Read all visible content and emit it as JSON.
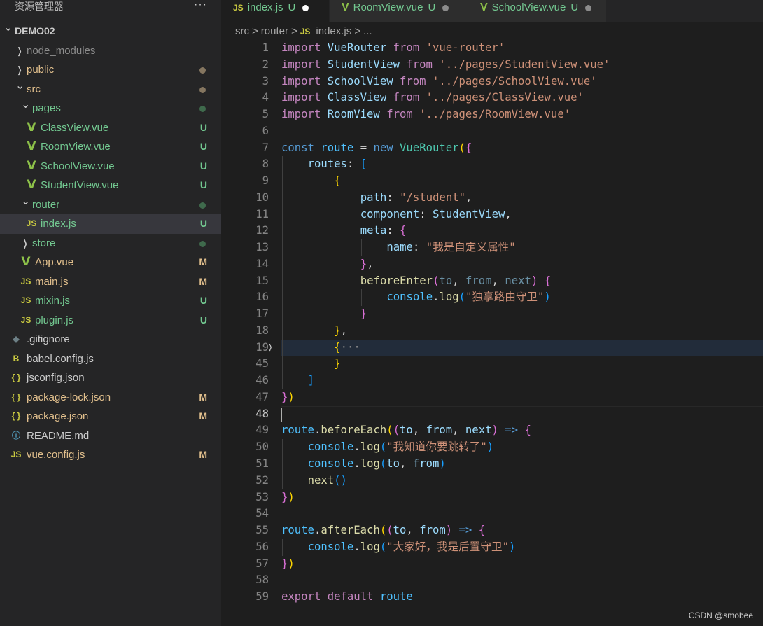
{
  "sidebar": {
    "title": "资源管理器",
    "more": "···",
    "items": [
      {
        "label": "DEMO02",
        "depth": 0,
        "kind": "folder-open",
        "color": "#cccccc",
        "bold": true
      },
      {
        "label": "node_modules",
        "depth": 1,
        "kind": "folder",
        "color": "#8c8c8c"
      },
      {
        "label": "public",
        "depth": 1,
        "kind": "folder",
        "color": "#e2c08d",
        "dot": "#857660"
      },
      {
        "label": "src",
        "depth": 1,
        "kind": "folder-open",
        "color": "#e2c08d",
        "dot": "#857660"
      },
      {
        "label": "pages",
        "depth": 2,
        "kind": "folder-open",
        "color": "#73c991",
        "dot": "#3f6a4c"
      },
      {
        "label": "ClassView.vue",
        "depth": 3,
        "kind": "vue",
        "color": "#73c991",
        "status": "U"
      },
      {
        "label": "RoomView.vue",
        "depth": 3,
        "kind": "vue",
        "color": "#73c991",
        "status": "U"
      },
      {
        "label": "SchoolView.vue",
        "depth": 3,
        "kind": "vue",
        "color": "#73c991",
        "status": "U"
      },
      {
        "label": "StudentView.vue",
        "depth": 3,
        "kind": "vue",
        "color": "#73c991",
        "status": "U"
      },
      {
        "label": "router",
        "depth": 2,
        "kind": "folder-open",
        "color": "#73c991",
        "dot": "#3f6a4c"
      },
      {
        "label": "index.js",
        "depth": 3,
        "kind": "js",
        "color": "#73c991",
        "status": "U",
        "selected": true
      },
      {
        "label": "store",
        "depth": 2,
        "kind": "folder",
        "color": "#73c991",
        "dot": "#3f6a4c"
      },
      {
        "label": "App.vue",
        "depth": 2,
        "kind": "vue",
        "color": "#e2c08d",
        "status": "M"
      },
      {
        "label": "main.js",
        "depth": 2,
        "kind": "js",
        "color": "#e2c08d",
        "status": "M"
      },
      {
        "label": "mixin.js",
        "depth": 2,
        "kind": "js",
        "color": "#73c991",
        "status": "U"
      },
      {
        "label": "plugin.js",
        "depth": 2,
        "kind": "js",
        "color": "#73c991",
        "status": "U"
      },
      {
        "label": ".gitignore",
        "depth": 1,
        "kind": "git",
        "color": "#cccccc"
      },
      {
        "label": "babel.config.js",
        "depth": 1,
        "kind": "babel",
        "color": "#cccccc"
      },
      {
        "label": "jsconfig.json",
        "depth": 1,
        "kind": "json",
        "color": "#cccccc"
      },
      {
        "label": "package-lock.json",
        "depth": 1,
        "kind": "json",
        "color": "#e2c08d",
        "status": "M"
      },
      {
        "label": "package.json",
        "depth": 1,
        "kind": "json",
        "color": "#e2c08d",
        "status": "M"
      },
      {
        "label": "README.md",
        "depth": 1,
        "kind": "info",
        "color": "#cccccc"
      },
      {
        "label": "vue.config.js",
        "depth": 1,
        "kind": "js",
        "color": "#e2c08d",
        "status": "M"
      }
    ]
  },
  "tabs": [
    {
      "label": "index.js",
      "status": "U",
      "icon": "js",
      "active": true
    },
    {
      "label": "RoomView.vue",
      "status": "U",
      "icon": "vue"
    },
    {
      "label": "SchoolView.vue",
      "status": "U",
      "icon": "vue"
    }
  ],
  "breadcrumb": {
    "parts": [
      "src",
      "router",
      "index.js",
      "..."
    ],
    "sep": ">"
  },
  "editor": {
    "current_line": "48",
    "folded_line": "19",
    "lines": [
      {
        "n": "1",
        "i": 0,
        "t": [
          [
            "import ",
            "k"
          ],
          [
            "VueRouter ",
            "v"
          ],
          [
            "from ",
            "k"
          ],
          [
            "'vue-router'",
            "s"
          ]
        ]
      },
      {
        "n": "2",
        "i": 0,
        "t": [
          [
            "import ",
            "k"
          ],
          [
            "StudentView ",
            "v"
          ],
          [
            "from ",
            "k"
          ],
          [
            "'../pages/StudentView.vue'",
            "s"
          ]
        ]
      },
      {
        "n": "3",
        "i": 0,
        "t": [
          [
            "import ",
            "k"
          ],
          [
            "SchoolView ",
            "v"
          ],
          [
            "from ",
            "k"
          ],
          [
            "'../pages/SchoolView.vue'",
            "s"
          ]
        ]
      },
      {
        "n": "4",
        "i": 0,
        "t": [
          [
            "import ",
            "k"
          ],
          [
            "ClassView ",
            "v"
          ],
          [
            "from ",
            "k"
          ],
          [
            "'../pages/ClassView.vue'",
            "s"
          ]
        ]
      },
      {
        "n": "5",
        "i": 0,
        "t": [
          [
            "import ",
            "k"
          ],
          [
            "RoomView ",
            "v"
          ],
          [
            "from ",
            "k"
          ],
          [
            "'../pages/RoomView.vue'",
            "s"
          ]
        ]
      },
      {
        "n": "6",
        "i": 0,
        "t": []
      },
      {
        "n": "7",
        "i": 0,
        "t": [
          [
            "const ",
            "b"
          ],
          [
            "route ",
            "c"
          ],
          [
            "= ",
            "p"
          ],
          [
            "new ",
            "b"
          ],
          [
            "VueRouter",
            "t"
          ],
          [
            "(",
            "y"
          ],
          [
            "{",
            "m"
          ]
        ]
      },
      {
        "n": "8",
        "i": 1,
        "t": [
          [
            "routes",
            "v"
          ],
          [
            ": ",
            "p"
          ],
          [
            "[",
            "l"
          ]
        ]
      },
      {
        "n": "9",
        "i": 2,
        "t": [
          [
            "{",
            "y"
          ]
        ]
      },
      {
        "n": "10",
        "i": 3,
        "t": [
          [
            "path",
            "v"
          ],
          [
            ": ",
            "p"
          ],
          [
            "\"/student\"",
            "s"
          ],
          [
            ",",
            "p"
          ]
        ]
      },
      {
        "n": "11",
        "i": 3,
        "t": [
          [
            "component",
            "v"
          ],
          [
            ": ",
            "p"
          ],
          [
            "StudentView",
            "v"
          ],
          [
            ",",
            "p"
          ]
        ]
      },
      {
        "n": "12",
        "i": 3,
        "t": [
          [
            "meta",
            "v"
          ],
          [
            ": ",
            "p"
          ],
          [
            "{",
            "m"
          ]
        ]
      },
      {
        "n": "13",
        "i": 4,
        "t": [
          [
            "name",
            "v"
          ],
          [
            ": ",
            "p"
          ],
          [
            "\"我是自定义属性\"",
            "s"
          ]
        ]
      },
      {
        "n": "14",
        "i": 3,
        "t": [
          [
            "}",
            "m"
          ],
          [
            ",",
            "p"
          ]
        ]
      },
      {
        "n": "15",
        "i": 3,
        "t": [
          [
            "beforeEnter",
            "f"
          ],
          [
            "(",
            "m"
          ],
          [
            "to",
            "d"
          ],
          [
            ", ",
            "p"
          ],
          [
            "from",
            "d"
          ],
          [
            ", ",
            "p"
          ],
          [
            "next",
            "d"
          ],
          [
            ") ",
            "m"
          ],
          [
            "{",
            "m"
          ]
        ]
      },
      {
        "n": "16",
        "i": 4,
        "t": [
          [
            "console",
            "c"
          ],
          [
            ".",
            "p"
          ],
          [
            "log",
            "f"
          ],
          [
            "(",
            "l"
          ],
          [
            "\"独享路由守卫\"",
            "s"
          ],
          [
            ")",
            "l"
          ]
        ]
      },
      {
        "n": "17",
        "i": 3,
        "t": [
          [
            "}",
            "m"
          ]
        ]
      },
      {
        "n": "18",
        "i": 2,
        "t": [
          [
            "}",
            "y"
          ],
          [
            ",",
            "p"
          ]
        ]
      },
      {
        "n": "19",
        "i": 2,
        "t": [
          [
            "{",
            "y"
          ],
          [
            "···",
            "e"
          ]
        ]
      },
      {
        "n": "45",
        "i": 2,
        "t": [
          [
            "}",
            "y"
          ]
        ]
      },
      {
        "n": "46",
        "i": 1,
        "t": [
          [
            "]",
            "l"
          ]
        ]
      },
      {
        "n": "47",
        "i": 0,
        "t": [
          [
            "}",
            "m"
          ],
          [
            ")",
            "y"
          ]
        ]
      },
      {
        "n": "48",
        "i": 0,
        "t": []
      },
      {
        "n": "49",
        "i": 0,
        "t": [
          [
            "route",
            "c"
          ],
          [
            ".",
            "p"
          ],
          [
            "beforeEach",
            "f"
          ],
          [
            "(",
            "y"
          ],
          [
            "(",
            "m"
          ],
          [
            "to",
            "v"
          ],
          [
            ", ",
            "p"
          ],
          [
            "from",
            "v"
          ],
          [
            ", ",
            "p"
          ],
          [
            "next",
            "v"
          ],
          [
            ") ",
            "m"
          ],
          [
            "=> ",
            "b"
          ],
          [
            "{",
            "m"
          ]
        ]
      },
      {
        "n": "50",
        "i": 1,
        "t": [
          [
            "console",
            "c"
          ],
          [
            ".",
            "p"
          ],
          [
            "log",
            "f"
          ],
          [
            "(",
            "l"
          ],
          [
            "\"我知道你要跳转了\"",
            "s"
          ],
          [
            ")",
            "l"
          ]
        ]
      },
      {
        "n": "51",
        "i": 1,
        "t": [
          [
            "console",
            "c"
          ],
          [
            ".",
            "p"
          ],
          [
            "log",
            "f"
          ],
          [
            "(",
            "l"
          ],
          [
            "to",
            "v"
          ],
          [
            ", ",
            "p"
          ],
          [
            "from",
            "v"
          ],
          [
            ")",
            "l"
          ]
        ]
      },
      {
        "n": "52",
        "i": 1,
        "t": [
          [
            "next",
            "f"
          ],
          [
            "()",
            "l"
          ]
        ]
      },
      {
        "n": "53",
        "i": 0,
        "t": [
          [
            "}",
            "m"
          ],
          [
            ")",
            "y"
          ]
        ]
      },
      {
        "n": "54",
        "i": 0,
        "t": []
      },
      {
        "n": "55",
        "i": 0,
        "t": [
          [
            "route",
            "c"
          ],
          [
            ".",
            "p"
          ],
          [
            "afterEach",
            "f"
          ],
          [
            "(",
            "y"
          ],
          [
            "(",
            "m"
          ],
          [
            "to",
            "v"
          ],
          [
            ", ",
            "p"
          ],
          [
            "from",
            "v"
          ],
          [
            ") ",
            "m"
          ],
          [
            "=> ",
            "b"
          ],
          [
            "{",
            "m"
          ]
        ]
      },
      {
        "n": "56",
        "i": 1,
        "t": [
          [
            "console",
            "c"
          ],
          [
            ".",
            "p"
          ],
          [
            "log",
            "f"
          ],
          [
            "(",
            "l"
          ],
          [
            "\"大家好，我是后置守卫\"",
            "s"
          ],
          [
            ")",
            "l"
          ]
        ]
      },
      {
        "n": "57",
        "i": 0,
        "t": [
          [
            "}",
            "m"
          ],
          [
            ")",
            "y"
          ]
        ]
      },
      {
        "n": "58",
        "i": 0,
        "t": []
      },
      {
        "n": "59",
        "i": 0,
        "t": [
          [
            "export ",
            "k"
          ],
          [
            "default ",
            "k"
          ],
          [
            "route",
            "c"
          ]
        ]
      }
    ]
  },
  "watermark": "CSDN @smobee"
}
